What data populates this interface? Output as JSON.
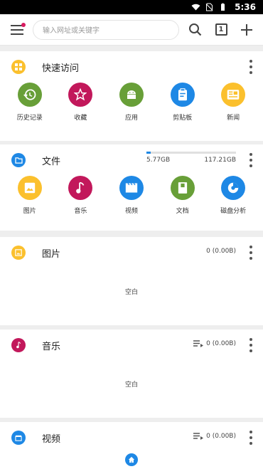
{
  "status_bar": {
    "time": "5:36"
  },
  "toolbar": {
    "search_placeholder": "输入网址或关键字",
    "tab_count": "1"
  },
  "quick_access": {
    "title": "快速访问",
    "items": [
      {
        "label": "历史记录",
        "color": "#689f38",
        "icon": "history-icon"
      },
      {
        "label": "收藏",
        "color": "#c2185b",
        "icon": "star-icon"
      },
      {
        "label": "应用",
        "color": "#689f38",
        "icon": "android-icon"
      },
      {
        "label": "剪贴板",
        "color": "#1e88e5",
        "icon": "clipboard-icon"
      },
      {
        "label": "新闻",
        "color": "#fbc02d",
        "icon": "news-icon"
      }
    ]
  },
  "files": {
    "title": "文件",
    "used": "5.77GB",
    "total": "117.21GB",
    "used_fraction": 0.049,
    "items": [
      {
        "label": "图片",
        "color": "#fbc02d",
        "icon": "image-icon"
      },
      {
        "label": "音乐",
        "color": "#c2185b",
        "icon": "music-icon"
      },
      {
        "label": "视频",
        "color": "#1e88e5",
        "icon": "video-icon"
      },
      {
        "label": "文档",
        "color": "#689f38",
        "icon": "document-icon"
      },
      {
        "label": "磁盘分析",
        "color": "#1e88e5",
        "icon": "disk-analysis-icon"
      }
    ]
  },
  "images_section": {
    "title": "图片",
    "count": "0 (0.00B)",
    "empty": "空白",
    "color": "#fbc02d"
  },
  "music_section": {
    "title": "音乐",
    "count": "0 (0.00B)",
    "empty": "空白",
    "color": "#c2185b"
  },
  "video_section": {
    "title": "视频",
    "count": "0 (0.00B)",
    "color": "#1e88e5"
  }
}
